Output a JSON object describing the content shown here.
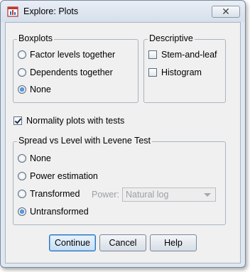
{
  "window": {
    "title": "Explore: Plots",
    "close_glyph": "✕"
  },
  "boxplots": {
    "legend": "Boxplots",
    "options": [
      {
        "label": "Factor levels together",
        "selected": false
      },
      {
        "label": "Dependents together",
        "selected": false
      },
      {
        "label": "None",
        "selected": true
      }
    ]
  },
  "descriptive": {
    "legend": "Descriptive",
    "options": [
      {
        "label": "Stem-and-leaf",
        "checked": false
      },
      {
        "label": "Histogram",
        "checked": false
      }
    ]
  },
  "normality": {
    "label": "Normality plots with tests",
    "checked": true
  },
  "spread": {
    "legend": "Spread vs Level with Levene Test",
    "options": [
      {
        "label": "None",
        "selected": false
      },
      {
        "label": "Power estimation",
        "selected": false
      },
      {
        "label": "Transformed",
        "selected": false
      },
      {
        "label": "Untransformed",
        "selected": true
      }
    ],
    "power_label": "Power:",
    "power_value": "Natural log"
  },
  "buttons": {
    "continue": "Continue",
    "cancel": "Cancel",
    "help": "Help"
  },
  "colors": {
    "dialog_bg": "#f0f0f0",
    "frame": "#dfe7f1",
    "accent": "#2f6fb5"
  }
}
